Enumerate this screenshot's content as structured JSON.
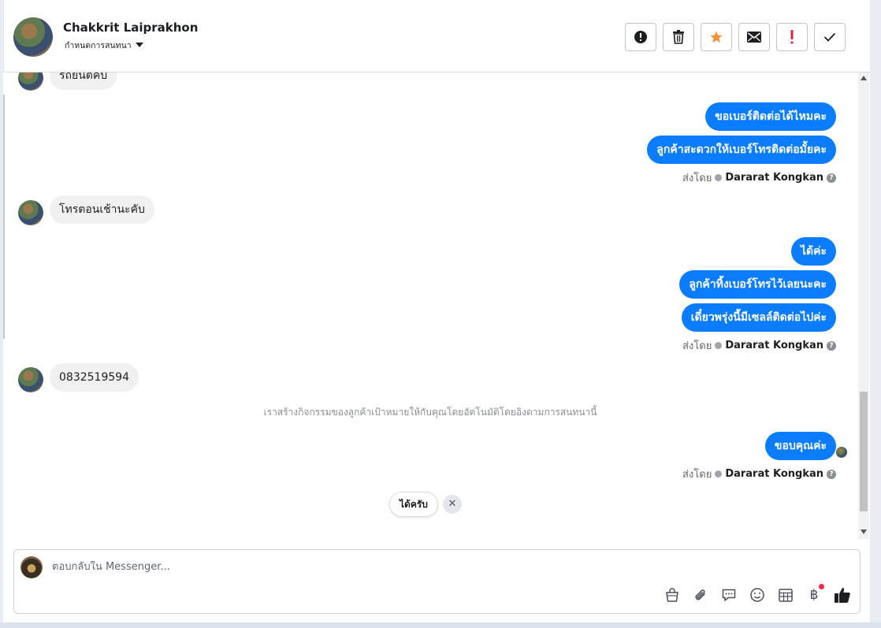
{
  "header": {
    "contact_name": "Chakkrit Laiprakhon",
    "assign_label": "กำหนดการสนทนา",
    "actions": [
      {
        "name": "report-spam-button",
        "icon": "alert-circle-icon"
      },
      {
        "name": "delete-button",
        "icon": "trash-icon"
      },
      {
        "name": "star-button",
        "icon": "star-icon"
      },
      {
        "name": "mark-unread-button",
        "icon": "envelope-icon"
      },
      {
        "name": "follow-up-button",
        "icon": "exclamation-icon"
      },
      {
        "name": "mark-done-button",
        "icon": "check-icon"
      }
    ],
    "colors": {
      "star": "#f7923b",
      "follow_up": "#e41e3f"
    }
  },
  "conversation": {
    "messages": [
      {
        "direction": "in",
        "text": "รถยนตคบ"
      },
      {
        "direction": "out",
        "text": "ขอเบอร์ติดต่อได้ไหมคะ"
      },
      {
        "direction": "out",
        "text": "ลูกค้าสะดวกให้เบอร์โทรติดต่อมั้ยคะ"
      },
      {
        "direction": "in",
        "text": "โทรตอนเช้านะคับ"
      },
      {
        "direction": "out",
        "text": "ได้ค่ะ"
      },
      {
        "direction": "out",
        "text": "ลูกค้าทิ้งเบอร์โทรไว้เลยนะคะ"
      },
      {
        "direction": "out",
        "text": "เดี๋ยวพรุ่งนี้มีเซลล์ติดต่อไปค่ะ"
      },
      {
        "direction": "in",
        "text": "0832519594"
      },
      {
        "direction": "out",
        "text": "ขอบคุณค่ะ"
      }
    ],
    "sent_by_prefix": "ส่งโดย",
    "sent_by_name": "Dararat Kongkan",
    "system_message": "เราสร้างกิจกรรมของลูกค้าเป้าหมายให้กับคุณโดยอัตโนมัติโดยอิงตามการสนทนานี้",
    "quick_reply": "ได้ครับ",
    "accent_color": "#0a7cff"
  },
  "composer": {
    "placeholder": "ตอบกลับใน Messenger...",
    "tools": [
      "shopping-bag-icon",
      "paperclip-icon",
      "saved-reply-icon",
      "emoji-icon",
      "appointment-icon",
      "baht-payment-icon",
      "like-icon"
    ],
    "baht_symbol": "฿"
  }
}
